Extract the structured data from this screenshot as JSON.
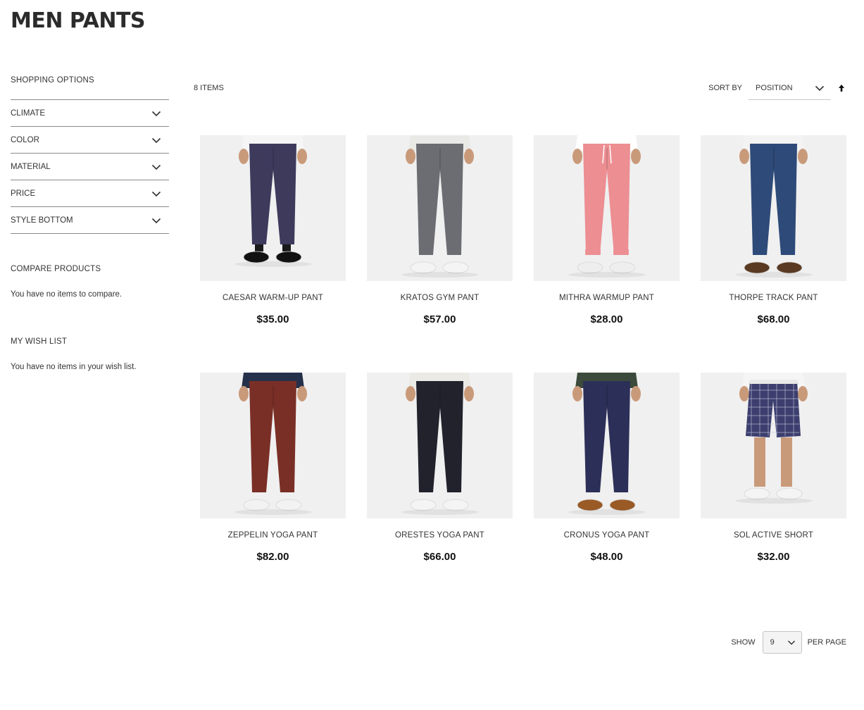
{
  "page": {
    "title": "MEN PANTS"
  },
  "sidebar": {
    "shopping_title": "SHOPPING OPTIONS",
    "filters": [
      {
        "label": "CLIMATE",
        "icon": "chevron-down-icon"
      },
      {
        "label": "COLOR",
        "icon": "chevron-down-icon"
      },
      {
        "label": "MATERIAL",
        "icon": "chevron-down-icon"
      },
      {
        "label": "PRICE",
        "icon": "chevron-down-icon"
      },
      {
        "label": "STYLE BOTTOM",
        "icon": "chevron-down-icon"
      }
    ],
    "compare": {
      "title": "COMPARE PRODUCTS",
      "message": "You have no items to compare."
    },
    "wishlist": {
      "title": "MY WISH LIST",
      "message": "You have no items in your wish list."
    }
  },
  "toolbar": {
    "items_count": "8 ITEMS",
    "sort_label": "SORT BY",
    "sort_value": "POSITION",
    "sort_direction_icon": "arrow-up-icon"
  },
  "products": [
    {
      "name": "CAESAR WARM-UP PANT",
      "price": "$35.00",
      "pant_color": "#3e3a5c",
      "top_color": "#f5f5f5",
      "shoe_color": "#111111",
      "style": "cropped"
    },
    {
      "name": "KRATOS GYM PANT",
      "price": "$57.00",
      "pant_color": "#6c6d72",
      "top_color": "#e9e9e6",
      "shoe_color": "#f4f4f4",
      "style": "tapered"
    },
    {
      "name": "MITHRA WARMUP PANT",
      "price": "$28.00",
      "pant_color": "#ec8e92",
      "top_color": "#ffffff",
      "shoe_color": "#eeeeee",
      "style": "jogger"
    },
    {
      "name": "THORPE TRACK PANT",
      "price": "$68.00",
      "pant_color": "#2e4a78",
      "top_color": "#f3f3f3",
      "shoe_color": "#5a3a22",
      "style": "straight"
    },
    {
      "name": "ZEPPELIN YOGA PANT",
      "price": "$82.00",
      "pant_color": "#7a2f26",
      "top_color": "#25304a",
      "shoe_color": "#f2f2f2",
      "style": "slim"
    },
    {
      "name": "ORESTES YOGA PANT",
      "price": "$66.00",
      "pant_color": "#22222d",
      "top_color": "#ebeae4",
      "shoe_color": "#f4f4f4",
      "style": "slim"
    },
    {
      "name": "CRONUS YOGA PANT",
      "price": "$48.00",
      "pant_color": "#2c2f58",
      "top_color": "#3b4a3a",
      "shoe_color": "#9a5a26",
      "style": "slim"
    },
    {
      "name": "SOL ACTIVE SHORT",
      "price": "$32.00",
      "pant_color": "#3c3f6e",
      "top_color": "#f5f5f5",
      "shoe_color": "#f4f4f4",
      "style": "short"
    }
  ],
  "pager": {
    "show_label": "SHOW",
    "limit_value": "9",
    "per_page_label": "PER PAGE"
  }
}
